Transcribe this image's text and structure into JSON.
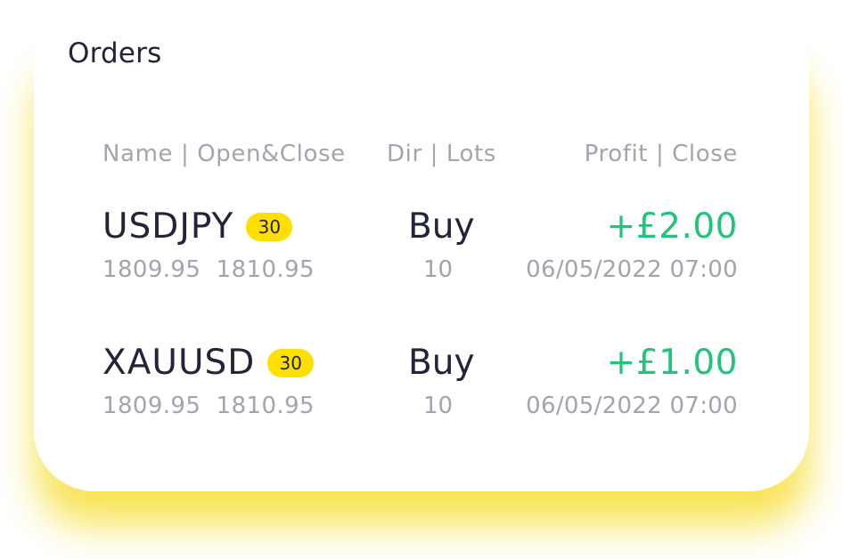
{
  "orders": {
    "title": "Orders",
    "headers": {
      "name": "Name | Open&Close",
      "dir": "Dir | Lots",
      "profit": "Profit | Close"
    },
    "rows": [
      {
        "symbol": "USDJPY",
        "leverage": "30",
        "direction": "Buy",
        "profit": "+£2.00",
        "prices": "1809.95  1810.95",
        "lots": "10",
        "close_time": "06/05/2022 07:00"
      },
      {
        "symbol": "XAUUSD",
        "leverage": "30",
        "direction": "Buy",
        "profit": "+£1.00",
        "prices": "1809.95  1810.95",
        "lots": "10",
        "close_time": "06/05/2022 07:00"
      }
    ]
  },
  "colors": {
    "accent_yellow": "#fddf00",
    "profit_green": "#22c37a",
    "text_dark": "#23243a",
    "text_muted": "#a3a4ad"
  }
}
